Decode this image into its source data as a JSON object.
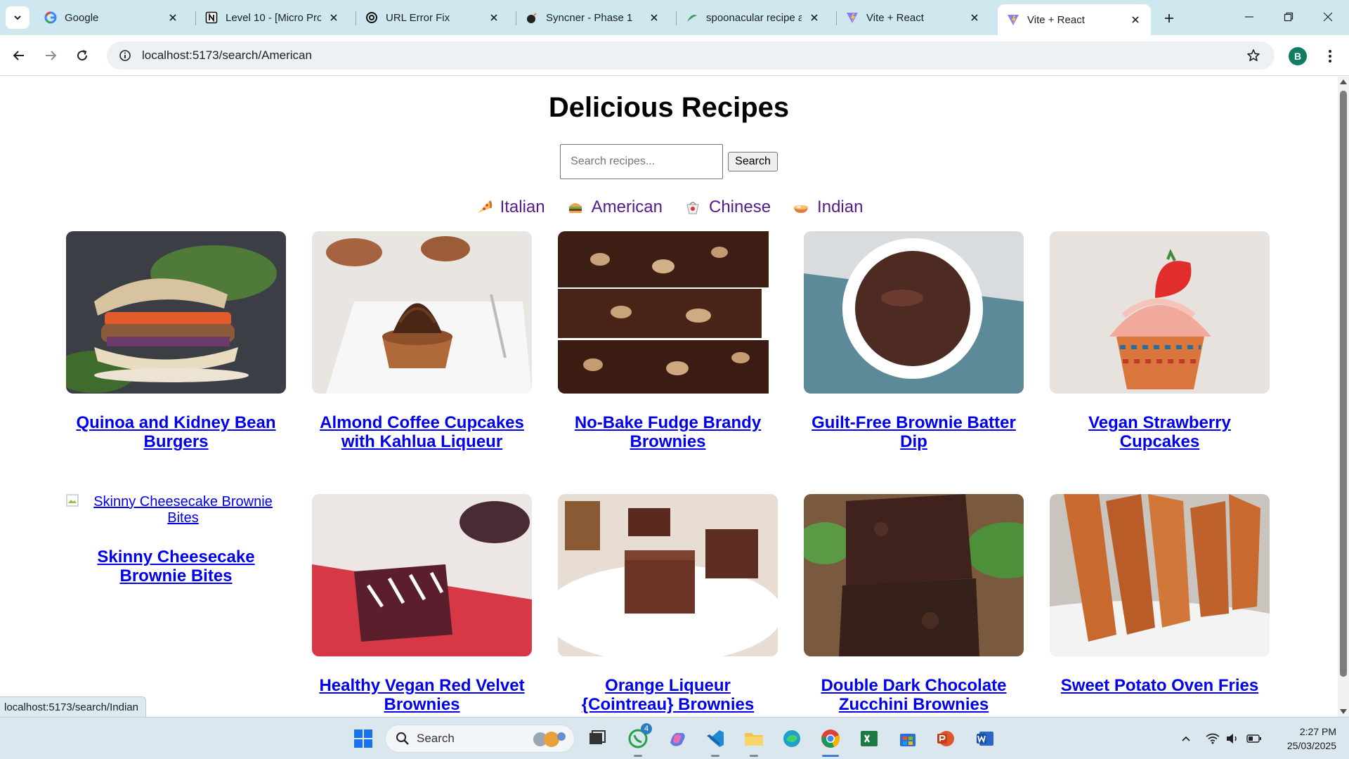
{
  "browser": {
    "tabs": [
      {
        "title": "Google",
        "icon": "google-icon"
      },
      {
        "title": "Level 10 - [Micro Pro",
        "icon": "notion-icon"
      },
      {
        "title": "URL Error Fix",
        "icon": "openai-icon"
      },
      {
        "title": "Syncner - Phase 1",
        "icon": "bomb-icon"
      },
      {
        "title": "spoonacular recipe a",
        "icon": "spoonacular-icon"
      },
      {
        "title": "Vite + React",
        "icon": "vite-icon"
      },
      {
        "title": "Vite + React",
        "icon": "vite-icon",
        "active": true
      }
    ],
    "url": "localhost:5173/search/American",
    "profile_initial": "B",
    "status_url": "localhost:5173/search/Indian"
  },
  "page": {
    "title": "Delicious Recipes",
    "search": {
      "placeholder": "Search recipes...",
      "button": "Search"
    },
    "cuisines": [
      {
        "label": "Italian",
        "icon": "pizza-icon"
      },
      {
        "label": "American",
        "icon": "burger-icon"
      },
      {
        "label": "Chinese",
        "icon": "takeout-box-icon"
      },
      {
        "label": "Indian",
        "icon": "curry-bowl-icon"
      }
    ],
    "recipes": [
      {
        "title": "Quinoa and Kidney Bean Burgers",
        "image": "veggie-burger-photo"
      },
      {
        "title": "Almond Coffee Cupcakes with Kahlua Liqueur",
        "image": "chocolate-cupcake-photo"
      },
      {
        "title": "No-Bake Fudge Brandy Brownies",
        "image": "walnut-fudge-photo"
      },
      {
        "title": "Guilt-Free Brownie Batter Dip",
        "image": "chocolate-dip-bowl-photo"
      },
      {
        "title": "Vegan Strawberry Cupcakes",
        "image": "strawberry-cupcake-photo"
      },
      {
        "title": "Skinny Cheesecake Brownie Bites",
        "image_alt": "Skinny Cheesecake Brownie Bites",
        "broken": true
      },
      {
        "title": "Healthy Vegan Red Velvet Brownies",
        "image": "red-velvet-brownie-photo"
      },
      {
        "title": "Orange Liqueur {Cointreau} Brownies",
        "image": "brownie-squares-photo"
      },
      {
        "title": "Double Dark Chocolate Zucchini Brownies",
        "image": "zucchini-brownie-photo"
      },
      {
        "title": "Sweet Potato Oven Fries",
        "image": "sweet-potato-fries-photo"
      }
    ]
  },
  "taskbar": {
    "search_label": "Search",
    "whatsapp_badge": "4",
    "time": "2:27 PM",
    "date": "25/03/2025"
  }
}
